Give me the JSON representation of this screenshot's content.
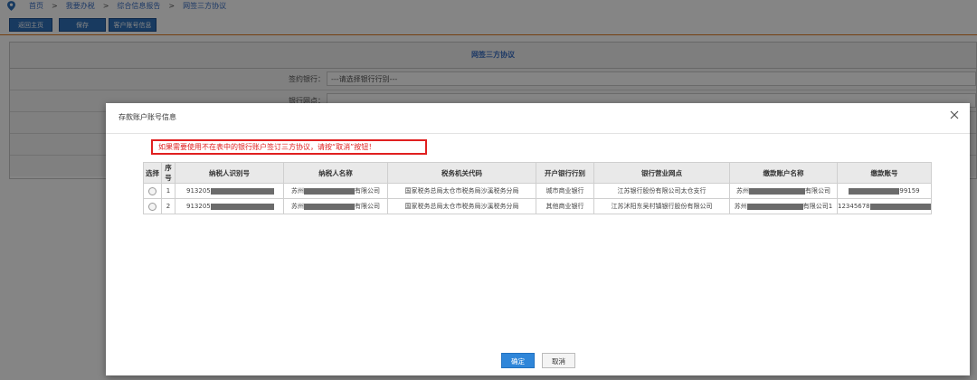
{
  "breadcrumb": {
    "items": [
      "首页",
      "我要办税",
      "综合信息报告",
      "网签三方协议"
    ],
    "separator": ">"
  },
  "toolbar": {
    "buttons": [
      "返回主页",
      "保存",
      "客户账号信息"
    ]
  },
  "form": {
    "title": "网签三方协议",
    "rows": [
      {
        "label": "签约银行：",
        "value": "---请选择银行行别---"
      },
      {
        "label": "银行网点：",
        "value": ""
      },
      {
        "label": "",
        "value": ""
      },
      {
        "label": "",
        "value": ""
      },
      {
        "label": "",
        "value": ""
      }
    ]
  },
  "modal": {
    "title": "存款账户账号信息",
    "notice": "如果需要使用不在表中的银行账户签订三方协议，请按“取消”按钮！",
    "columns": [
      "选择",
      "序号",
      "纳税人识别号",
      "纳税人名称",
      "税务机关代码",
      "开户银行行别",
      "银行营业网点",
      "缴款账户名称",
      "缴款账号"
    ],
    "rows": [
      {
        "seq": "1",
        "taxid_prefix": "913205",
        "name_prefix": "苏州",
        "name_suffix": "有限公司",
        "tax_office": "国家税务总局太仓市税务局沙溪税务分局",
        "bank_type": "城市商业银行",
        "branch": "江苏银行股份有限公司太仓支行",
        "acct_name_prefix": "苏州",
        "acct_name_suffix": "有限公司",
        "acct_no_prefix": "",
        "acct_no_suffix": "99159"
      },
      {
        "seq": "2",
        "taxid_prefix": "913205",
        "name_prefix": "苏州",
        "name_suffix": "有限公司",
        "tax_office": "国家税务总局太仓市税务局沙溪税务分局",
        "bank_type": "其他商业银行",
        "branch": "江苏沭阳东吴村镇银行股份有限公司",
        "acct_name_prefix": "苏州",
        "acct_name_suffix": "有限公司1",
        "acct_no_prefix": "12345678",
        "acct_no_suffix": ""
      }
    ],
    "ok_label": "确定",
    "cancel_label": "取消"
  },
  "colors": {
    "accent": "#2f86d9",
    "toolbar": "#2f6fb8",
    "warning": "#e02020",
    "divider": "#e07a1f"
  },
  "icons": {
    "breadcrumb": "location-pin-icon",
    "close": "close-icon"
  }
}
